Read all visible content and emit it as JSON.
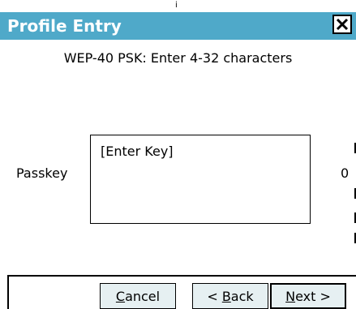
{
  "window": {
    "title": "Profile Entry",
    "close_icon": "close-icon",
    "titlebar_color": "#4fa9c9"
  },
  "top_strip_char": "i",
  "instruction": "WEP-40 PSK: Enter 4-32 characters",
  "passkey": {
    "label": "Passkey",
    "value": "[Enter Key]",
    "char_count": "0"
  },
  "buttons": {
    "cancel": {
      "mnemonic": "C",
      "rest": "ancel"
    },
    "back": {
      "prefix": "< ",
      "mnemonic": "B",
      "rest": "ack"
    },
    "next": {
      "mnemonic": "N",
      "rest": "ext >"
    }
  }
}
